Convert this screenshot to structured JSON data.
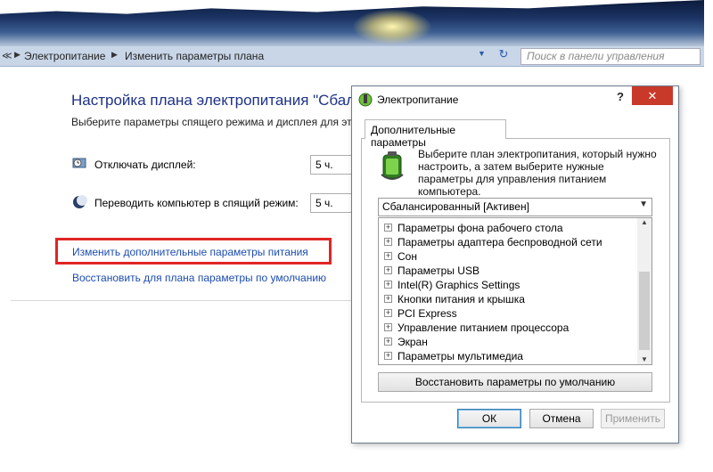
{
  "address_bar": {
    "crumbs": [
      "Электропитание",
      "Изменить параметры плана"
    ],
    "search_placeholder": "Поиск в панели управления"
  },
  "control_panel": {
    "title": "Настройка плана электропитания \"Сбаланс",
    "subtitle": "Выберите параметры спящего режима и дисплея для это",
    "rows": [
      {
        "label": "Отключать дисплей:",
        "value": "5 ч."
      },
      {
        "label": "Переводить компьютер в спящий режим:",
        "value": "5 ч."
      }
    ],
    "link_advanced": "Изменить дополнительные параметры питания",
    "link_restore": "Восстановить для плана параметры по умолчанию"
  },
  "dialog": {
    "title": "Электропитание",
    "help": "?",
    "close": "✕",
    "tab_label": "Дополнительные параметры",
    "description": "Выберите план электропитания, который нужно настроить, а затем выберите нужные параметры для управления питанием компьютера.",
    "plan_select": "Сбалансированный [Активен]",
    "tree_items": [
      "Параметры фона рабочего стола",
      "Параметры адаптера беспроводной сети",
      "Сон",
      "Параметры USB",
      "Intel(R) Graphics Settings",
      "Кнопки питания и крышка",
      "PCI Express",
      "Управление питанием процессора",
      "Экран",
      "Параметры мультимедиа"
    ],
    "restore_button": "Восстановить параметры по умолчанию",
    "ok_button": "ОК",
    "cancel_button": "Отмена",
    "apply_button": "Применить"
  }
}
